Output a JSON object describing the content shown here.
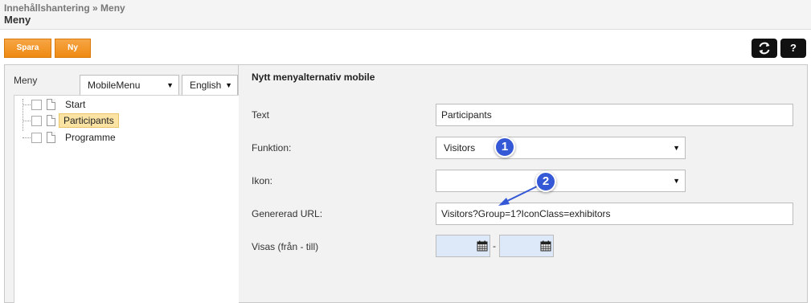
{
  "header": {
    "breadcrumb": "Innehållshantering » Meny",
    "title": "Meny"
  },
  "toolbar": {
    "save_label": "Spara",
    "new_label": "Ny",
    "refresh_icon": "refresh-icon",
    "help_label": "?"
  },
  "menu_panel": {
    "label": "Meny",
    "menu_select": "MobileMenu",
    "language_select": "English",
    "items": [
      {
        "label": "Start"
      },
      {
        "label": "Participants"
      },
      {
        "label": "Programme"
      }
    ]
  },
  "form": {
    "title": "Nytt menyalternativ mobile",
    "text_label": "Text",
    "text_value": "Participants",
    "function_label": "Funktion:",
    "function_value": "Visitors",
    "icon_label": "Ikon:",
    "icon_value": "",
    "url_label": "Genererad URL:",
    "url_value": "Visitors?Group=1?IconClass=exhibitors",
    "visible_label": "Visas (från - till)",
    "date_separator": "-"
  },
  "annotations": {
    "marker_1": "1",
    "marker_2": "2"
  },
  "colors": {
    "accent_orange": "#ee8a12",
    "marker_blue": "#3558d6",
    "selected_item": "#fbe3a3"
  }
}
